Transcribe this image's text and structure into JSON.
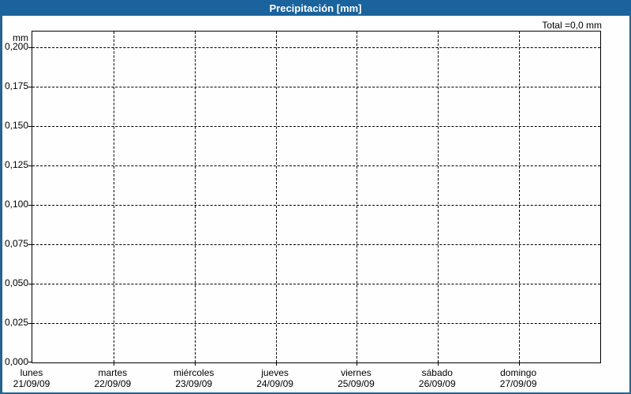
{
  "header": {
    "title": "Precipitación [mm]",
    "total_label": "Total =0,0 mm"
  },
  "colors": {
    "header_bg": "#1a639c",
    "frame_border": "#26648f",
    "background": "#fdfefd",
    "ink": "#000000",
    "title_text": "#ffffff"
  },
  "chart_data": {
    "type": "bar",
    "title": "Precipitación [mm]",
    "xlabel": "",
    "ylabel": "mm",
    "total_label": "Total =0,0 mm",
    "grid": "dashed",
    "legend_position": "none",
    "ylim": [
      0,
      0.21
    ],
    "categories": [
      {
        "day": "lunes",
        "date": "21/09/09"
      },
      {
        "day": "martes",
        "date": "22/09/09"
      },
      {
        "day": "miércoles",
        "date": "23/09/09"
      },
      {
        "day": "jueves",
        "date": "24/09/09"
      },
      {
        "day": "viernes",
        "date": "25/09/09"
      },
      {
        "day": "sábado",
        "date": "26/09/09"
      },
      {
        "day": "domingo",
        "date": "27/09/09"
      }
    ],
    "series": [
      {
        "name": "Precipitación",
        "values": [
          0,
          0,
          0,
          0,
          0,
          0,
          0
        ]
      }
    ],
    "total_mm": 0.0,
    "y_ticks": [
      {
        "value": 0.0,
        "label": "0,000"
      },
      {
        "value": 0.025,
        "label": "0,025"
      },
      {
        "value": 0.05,
        "label": "0,050"
      },
      {
        "value": 0.075,
        "label": "0,075"
      },
      {
        "value": 0.1,
        "label": "0,100"
      },
      {
        "value": 0.125,
        "label": "0,125"
      },
      {
        "value": 0.15,
        "label": "0,150"
      },
      {
        "value": 0.175,
        "label": "0,175"
      },
      {
        "value": 0.2,
        "label": "0,200"
      }
    ]
  }
}
